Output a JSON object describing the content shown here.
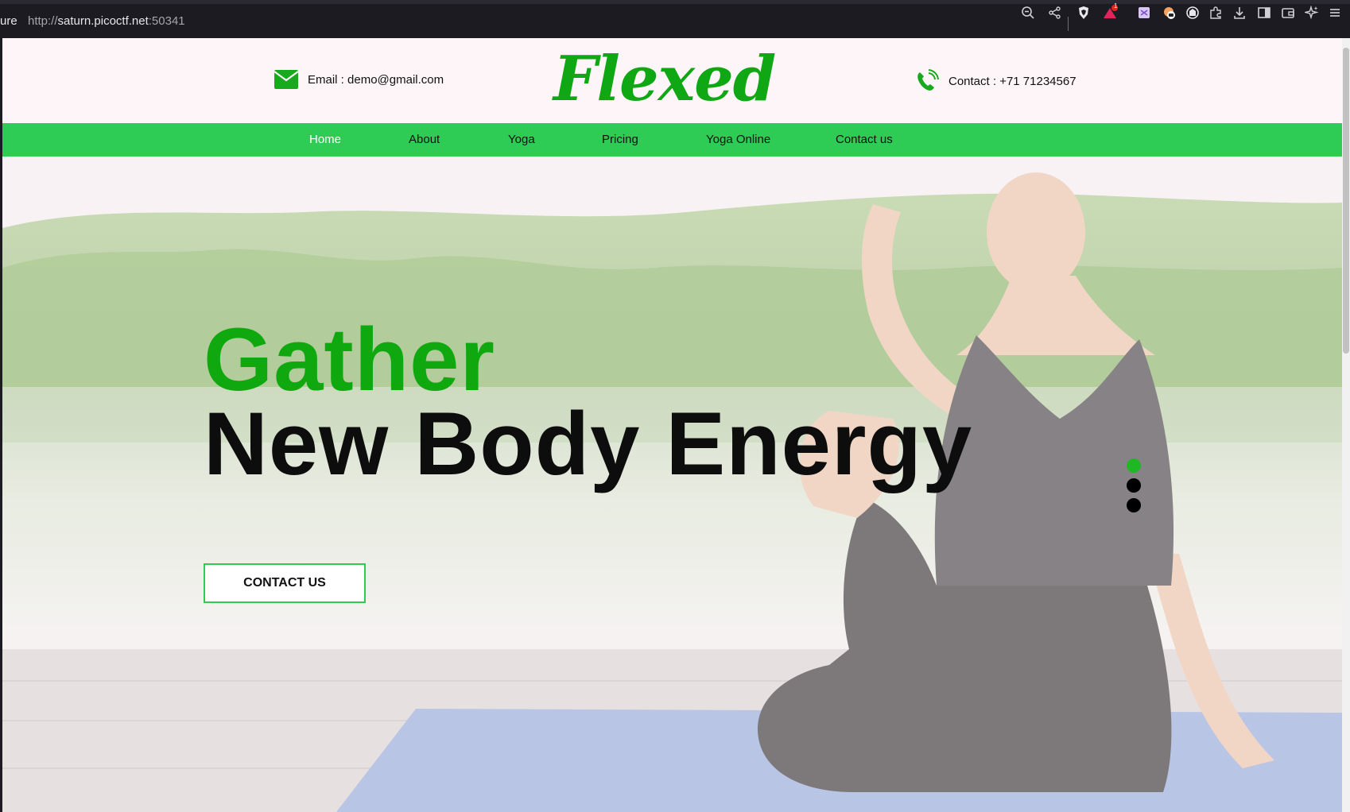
{
  "browser": {
    "url_fragment": "ure",
    "url_scheme": "http://",
    "url_host": "saturn.picoctf.net",
    "url_port": ":50341",
    "toolbar_icons": [
      "zoom-out-icon",
      "share-icon",
      "brave-shield-icon",
      "brave-rewards-icon",
      "extension-icon",
      "extension-icon",
      "extension-icon",
      "puzzle-icon",
      "download-icon",
      "sidebar-icon",
      "wallet-icon",
      "leo-icon",
      "menu-icon"
    ],
    "rewards_badge": "1"
  },
  "header": {
    "email": "Email : demo@gmail.com",
    "logo": "Flexed",
    "contact": "Contact : +71 71234567"
  },
  "nav": {
    "items": [
      "Home",
      "About",
      "Yoga",
      "Pricing",
      "Yoga Online",
      "Contact us"
    ],
    "active": "Home"
  },
  "hero": {
    "line1": "Gather",
    "line2": "New Body Energy",
    "cta": "CONTACT US",
    "slides": 3,
    "active_slide": 1
  },
  "colors": {
    "brand_green": "#2ecc54",
    "heading_green": "#0fa80f",
    "logo_green": "#0fa814"
  }
}
